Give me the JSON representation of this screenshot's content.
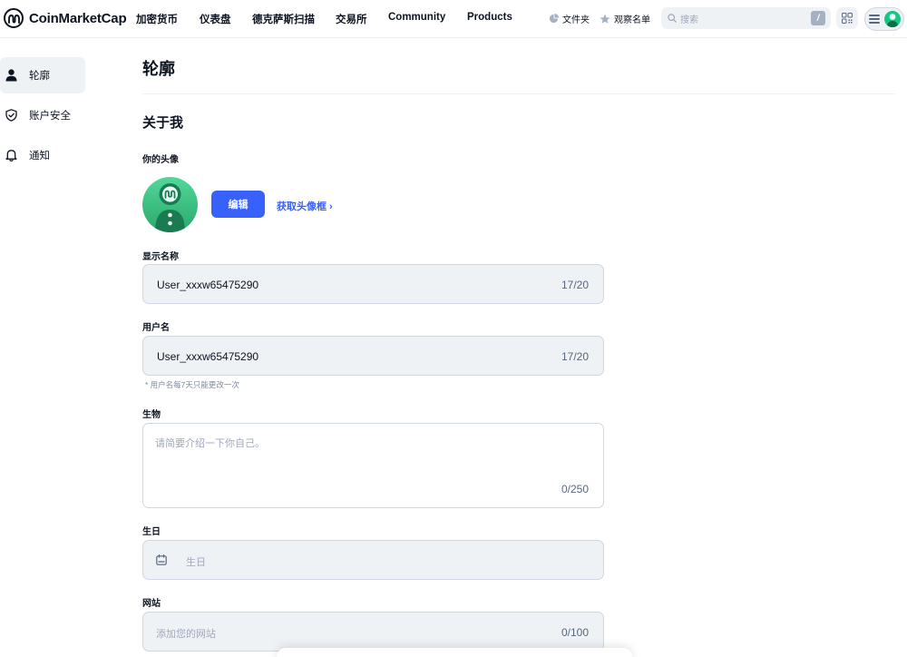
{
  "nav": {
    "logo_text": "CoinMarketCap",
    "links": [
      "加密货币",
      "仪表盘",
      "德克萨斯扫描",
      "交易所",
      "Community",
      "Products"
    ],
    "portfolio_label": "文件夹",
    "watchlist_label": "观察名单",
    "search_placeholder": "搜索",
    "search_shortcut": "/"
  },
  "sidebar": {
    "items": [
      {
        "label": "轮廓",
        "icon": "user-icon",
        "active": true
      },
      {
        "label": "账户安全",
        "icon": "shield-check-icon",
        "active": false
      },
      {
        "label": "通知",
        "icon": "bell-icon",
        "active": false
      }
    ]
  },
  "main": {
    "page_title": "轮廓",
    "section_title": "关于我",
    "avatar_label": "你的头像",
    "edit_button": "编辑",
    "get_frame_link": "获取头像框 ›",
    "display_name": {
      "label": "显示名称",
      "value": "User_xxxw65475290",
      "counter": "17/20"
    },
    "username": {
      "label": "用户名",
      "value": "User_xxxw65475290",
      "counter": "17/20",
      "hint": "* 用户名每7天只能更改一次"
    },
    "bio": {
      "label": "生物",
      "placeholder": "请简要介绍一下你自己。",
      "counter": "0/250"
    },
    "birthday": {
      "label": "生日",
      "placeholder": "生日"
    },
    "website": {
      "label": "网站",
      "placeholder": "添加您的网站",
      "counter": "0/100"
    }
  },
  "colors": {
    "accent": "#3861fb",
    "input_bg": "#eff2f5",
    "brand_green": "#16c784"
  }
}
